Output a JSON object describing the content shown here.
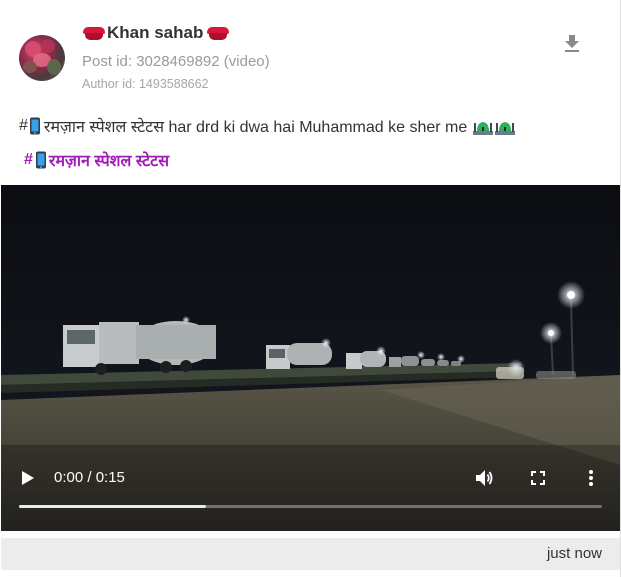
{
  "post": {
    "username": "Khan sahab",
    "post_id_text": "Post id: 3028469892 (video)",
    "author_id_text": "Author id: 1493588662",
    "caption_prefix": "#",
    "caption_text": "रमज़ान स्पेशल स्टेटस har drd ki dwa hai Muhammad ke sher me",
    "hashtag_prefix": "#",
    "hashtag_text": "रमज़ान स्पेशल स्टेटस",
    "timestamp": "just now"
  },
  "video": {
    "time_display": "0:00 / 0:15",
    "progress": 0.32
  },
  "icons": {
    "name_left": "lips-icon",
    "name_right": "lips-icon",
    "download": "download-icon",
    "caption_phone": "mobile-phone-icon",
    "caption_end": "mosque-icon",
    "play": "play-icon",
    "volume": "volume-icon",
    "fullscreen": "fullscreen-icon",
    "more": "more-vertical-icon"
  },
  "colors": {
    "hashtag": "#a01eb7",
    "lips": "#d6173b",
    "footer_bg": "#ececec"
  }
}
